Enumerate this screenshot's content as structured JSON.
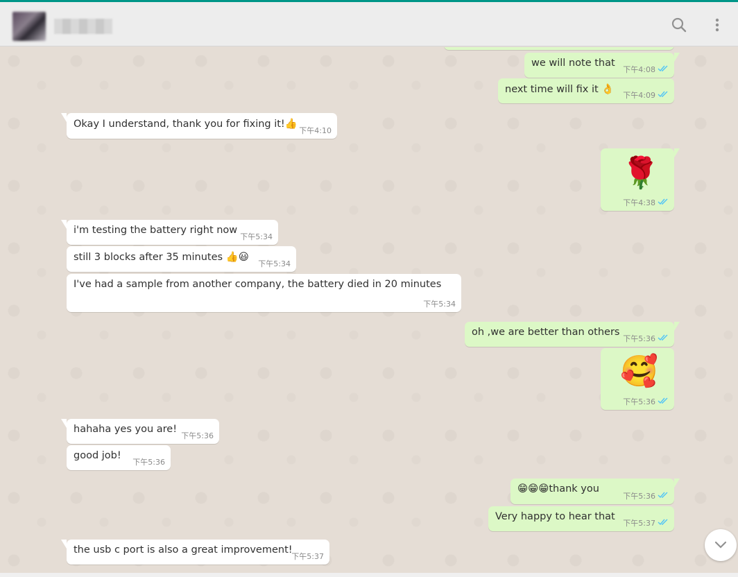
{
  "header": {
    "contact_name": "",
    "search_icon": "search-icon",
    "menu_icon": "menu-dots-icon"
  },
  "colors": {
    "accent": "#009688",
    "incoming_bubble": "#ffffff",
    "outgoing_bubble": "#dcf8c6",
    "read_ticks": "#4fc3f7",
    "wallpaper": "#e5ddd5"
  },
  "messages": [
    {
      "dir": "out",
      "text": "we will note that",
      "time": "下午4:08"
    },
    {
      "dir": "out",
      "text": "next time will fix it 👌",
      "time": "下午4:09"
    },
    {
      "dir": "in",
      "text": "Okay I understand, thank you for fixing it!👍",
      "time": "下午4:10"
    },
    {
      "dir": "out",
      "text": "🌹",
      "time": "下午4:38"
    },
    {
      "dir": "in",
      "text": "i'm testing the battery right now",
      "time": "下午5:34"
    },
    {
      "dir": "in",
      "text": "still 3 blocks after 35 minutes 👍😃",
      "time": "下午5:34"
    },
    {
      "dir": "in",
      "text": "I've had a sample from another company, the battery died in 20 minutes",
      "time": "下午5:34"
    },
    {
      "dir": "out",
      "text": "oh ,we are better than others",
      "time": "下午5:36"
    },
    {
      "dir": "out",
      "text": "🥰",
      "time": "下午5:36"
    },
    {
      "dir": "in",
      "text": "hahaha yes you are!",
      "time": "下午5:36"
    },
    {
      "dir": "in",
      "text": "good job!",
      "time": "下午5:36"
    },
    {
      "dir": "out",
      "text": "😁😁😁thank you",
      "time": "下午5:36"
    },
    {
      "dir": "out",
      "text": "Very happy  to hear that",
      "time": "下午5:37"
    },
    {
      "dir": "in",
      "text": "the usb c port is also a great improvement!",
      "time": "下午5:37"
    }
  ],
  "scroll_down_icon": "chevron-down-icon"
}
